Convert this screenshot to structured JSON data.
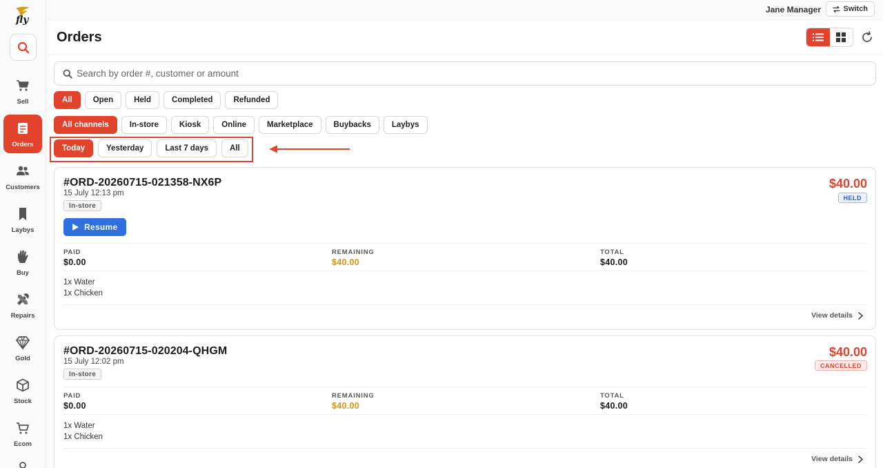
{
  "brand": {
    "logo_text": "fly",
    "accent": "#e2432d"
  },
  "topbar": {
    "user_name": "Jane Manager",
    "switch_label": "Switch"
  },
  "sidebar": {
    "items": [
      {
        "label": "Sell",
        "icon": "cart-icon",
        "active": false
      },
      {
        "label": "Orders",
        "icon": "orders-icon",
        "active": true
      },
      {
        "label": "Customers",
        "icon": "customers-icon",
        "active": false
      },
      {
        "label": "Laybys",
        "icon": "bookmark-icon",
        "active": false
      },
      {
        "label": "Buy",
        "icon": "hand-icon",
        "active": false
      },
      {
        "label": "Repairs",
        "icon": "tools-icon",
        "active": false
      },
      {
        "label": "Gold",
        "icon": "diamond-icon",
        "active": false
      },
      {
        "label": "Stock",
        "icon": "box-icon",
        "active": false
      },
      {
        "label": "Ecom",
        "icon": "shopping-cart-icon",
        "active": false
      }
    ]
  },
  "header": {
    "title": "Orders",
    "view_mode": "list"
  },
  "search": {
    "placeholder": "Search by order #, customer or amount",
    "value": ""
  },
  "status_filters": {
    "items": [
      "All",
      "Open",
      "Held",
      "Completed",
      "Refunded"
    ],
    "active": "All"
  },
  "channel_filters": {
    "items": [
      "All channels",
      "In-store",
      "Kiosk",
      "Online",
      "Marketplace",
      "Buybacks",
      "Laybys"
    ],
    "active": "All channels"
  },
  "date_filters": {
    "items": [
      "Today",
      "Yesterday",
      "Last 7 days",
      "All"
    ],
    "active": "Today"
  },
  "orders": [
    {
      "id": "#ORD-20260715-021358-NX6P",
      "date": "15 July 12:13 pm",
      "channel": "In-store",
      "amount": "$40.00",
      "status": "HELD",
      "action": "Resume",
      "paid_label": "PAID",
      "paid": "$0.00",
      "remaining_label": "REMAINING",
      "remaining": "$40.00",
      "total_label": "TOTAL",
      "total": "$40.00",
      "items": [
        "1x Water",
        "1x Chicken"
      ],
      "details_label": "View details"
    },
    {
      "id": "#ORD-20260715-020204-QHGM",
      "date": "15 July 12:02 pm",
      "channel": "In-store",
      "amount": "$40.00",
      "status": "CANCELLED",
      "paid_label": "PAID",
      "paid": "$0.00",
      "remaining_label": "REMAINING",
      "remaining": "$40.00",
      "total_label": "TOTAL",
      "total": "$40.00",
      "items": [
        "1x Water",
        "1x Chicken"
      ],
      "details_label": "View details"
    }
  ]
}
